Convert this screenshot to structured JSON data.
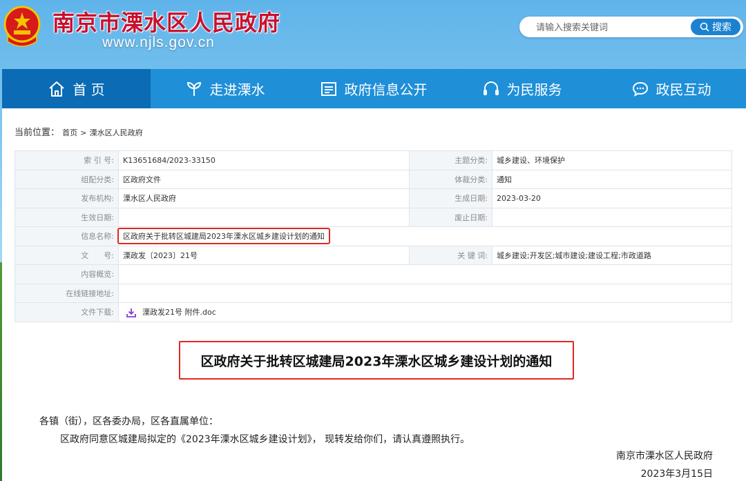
{
  "site": {
    "title": "南京市溧水区人民政府",
    "url": "www.njls.gov.cn"
  },
  "search": {
    "placeholder": "请输入搜索关键词",
    "button_label": "搜索"
  },
  "nav": {
    "items": [
      {
        "label": "首 页",
        "icon": "home-icon",
        "active": true
      },
      {
        "label": "走进溧水",
        "icon": "leaf-icon",
        "active": false
      },
      {
        "label": "政府信息公开",
        "icon": "document-icon",
        "active": false
      },
      {
        "label": "为民服务",
        "icon": "headset-icon",
        "active": false
      },
      {
        "label": "政民互动",
        "icon": "chat-icon",
        "active": false
      }
    ]
  },
  "breadcrumb": {
    "label": "当前位置：",
    "home": "首页",
    "separator": ">",
    "current": "溧水区人民政府"
  },
  "meta": {
    "index_no_label": "索 引 号:",
    "index_no": "K13651684/2023-33150",
    "topic_label": "主题分类:",
    "topic": "城乡建设、环境保护",
    "org_category_label": "组配分类:",
    "org_category": "区政府文件",
    "genre_label": "体裁分类:",
    "genre": "通知",
    "publisher_label": "发布机构:",
    "publisher": "溧水区人民政府",
    "created_label": "生成日期:",
    "created": "2023-03-20",
    "effective_label": "生效日期:",
    "effective": "",
    "expiry_label": "废止日期:",
    "expiry": "",
    "info_name_label": "信息名称:",
    "info_name": "区政府关于批转区城建局2023年溧水区城乡建设计划的通知",
    "doc_no_label": "文　　号:",
    "doc_no": "溧政发〔2023〕21号",
    "keywords_label": "关 键 词:",
    "keywords": "城乡建设;开发区;城市建设;建设工程;市政道路",
    "summary_label": "内容概览:",
    "summary": "",
    "link_label": "在线链接地址:",
    "link": "",
    "download_label": "文件下载:",
    "download_file": "溧政发21号 附件.doc"
  },
  "document": {
    "title": "区政府关于批转区城建局2023年溧水区城乡建设计划的通知",
    "salutation": "各镇（街），区各委办局，区各直属单位：",
    "body": "区政府同意区城建局拟定的《2023年溧水区城乡建设计划》， 现转发给你们，请认真遵照执行。",
    "signature_org": "南京市溧水区人民政府",
    "signature_date": "2023年3月15日"
  },
  "colors": {
    "nav_bg": "#1f8fd8",
    "nav_active": "#0b6bb4",
    "title_red": "#c8102e",
    "highlight_red": "#e0271e",
    "search_button": "#1b82d1"
  }
}
